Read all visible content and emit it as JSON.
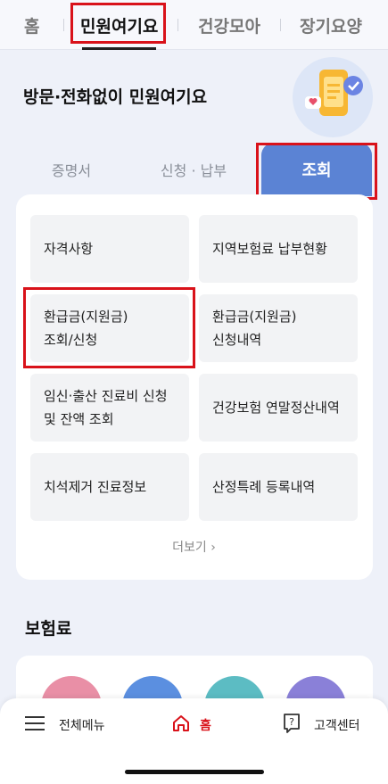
{
  "top_nav": {
    "tabs": [
      "홈",
      "민원여기요",
      "건강모아",
      "장기요양"
    ],
    "active_index": 1
  },
  "hero": {
    "title": "방문·전화없이 민원여기요"
  },
  "segment_tabs": {
    "tabs": [
      "증명서",
      "신청 · 납부",
      "조회"
    ],
    "active_index": 2
  },
  "menu_tiles": [
    [
      "자격사항"
    ],
    [
      "지역보험료 납부현황"
    ],
    [
      "환급금(지원금)",
      "조회/신청"
    ],
    [
      "환급금(지원금)",
      "신청내역"
    ],
    [
      "임신·출산 진료비 신청",
      "및 잔액 조회"
    ],
    [
      "건강보험 연말정산내역"
    ],
    [
      "치석제거 진료정보"
    ],
    [
      "산정특례 등록내역"
    ]
  ],
  "more_label": "더보기",
  "insurance_section": {
    "title": "보험료"
  },
  "bottom_nav": {
    "menu_label": "전체메뉴",
    "home_label": "홈",
    "help_label": "고객센터"
  },
  "colors": {
    "accent_blue": "#5b83d4",
    "highlight_red": "#d9121a",
    "circle_pink": "#e98fa6",
    "circle_blue": "#5b8fe0",
    "circle_teal": "#5cbcc3",
    "circle_purple": "#8a80d8"
  }
}
